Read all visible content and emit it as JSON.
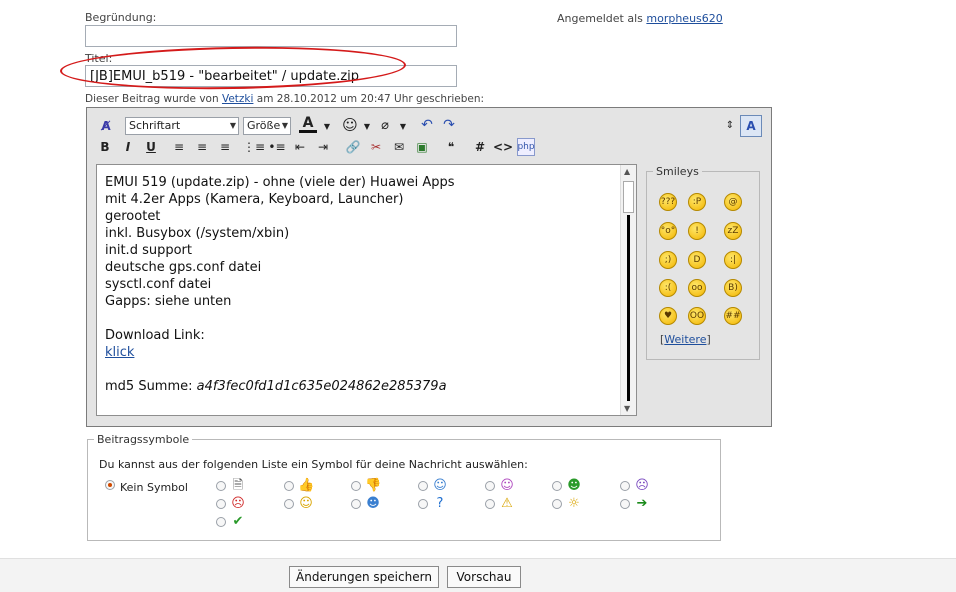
{
  "form": {
    "reason_label": "Begründung:",
    "reason_value": "",
    "title_label": "Titel:",
    "title_value": "[JB]EMUI_b519 - \"bearbeitet\" / update.zip",
    "post_info": {
      "prefix": "Dieser Beitrag wurde von ",
      "author": "Vetzki",
      "middle": " am 28.10.2012 um 20:47 Uhr geschrieben:"
    }
  },
  "login": {
    "text": "Angemeldet als ",
    "user": "morpheus620"
  },
  "toolbar": {
    "font_label": "Schriftart",
    "size_label": "Größe",
    "bold": "B",
    "italic": "I",
    "underline": "U",
    "font_color_letter": "A",
    "hash": "#",
    "code": "<>"
  },
  "editor": {
    "lines": [
      "EMUI 519 (update.zip) - ohne (viele der) Huawei Apps",
      "mit 4.2er Apps (Kamera, Keyboard, Launcher)",
      "gerootet",
      "inkl. Busybox (/system/xbin)",
      "init.d support",
      "deutsche gps.conf datei",
      "sysctl.conf datei",
      "Gapps: siehe unten"
    ],
    "download_label": "Download Link:",
    "download_link": "klick",
    "md5_label": "md5 Summe: ",
    "md5_value": "a4f3fec0fd1d1c635e024862e285379a"
  },
  "smileys": {
    "title": "Smileys",
    "more_open": "[",
    "more_label": "Weitere",
    "more_close": "]",
    "rows": [
      [
        "confused-smiley",
        "tongue-smiley",
        "dizzy-smiley"
      ],
      [
        "surprised-smiley",
        "shocked-smiley",
        "sleepy-smiley"
      ],
      [
        "wink-smiley",
        "grin-smiley",
        "neutral-smiley"
      ],
      [
        "sad-smiley",
        "rolling-eyes-smiley",
        "cool-thumbs-smiley"
      ],
      [
        "in-love-smiley",
        "eyes-smiley",
        "big-grin-smiley"
      ]
    ],
    "faces": [
      [
        "???",
        ":P",
        "@"
      ],
      [
        "°o°",
        "!",
        "zZ"
      ],
      [
        ";)",
        "D",
        ":|"
      ],
      [
        ":(",
        "oo",
        "B)"
      ],
      [
        "♥",
        "OO",
        "##"
      ]
    ]
  },
  "symbols": {
    "legend": "Beitragssymbole",
    "instruction": "Du kannst aus der folgenden Liste ein Symbol für deine Nachricht auswählen:",
    "none_label": "Kein Symbol",
    "items": [
      "document-icon",
      "thumbs-up-icon",
      "thumbs-down-icon",
      "smile-blue-icon",
      "smile-purple-icon",
      "grin-green-icon",
      "sad-purple-icon",
      "angry-red-icon",
      "smile-yellow-icon",
      "cool-icon",
      "question-icon",
      "warning-icon",
      "lightbulb-icon",
      "arrow-right-icon",
      "checkmark-icon"
    ]
  },
  "buttons": {
    "save": "Änderungen speichern",
    "preview": "Vorschau"
  }
}
